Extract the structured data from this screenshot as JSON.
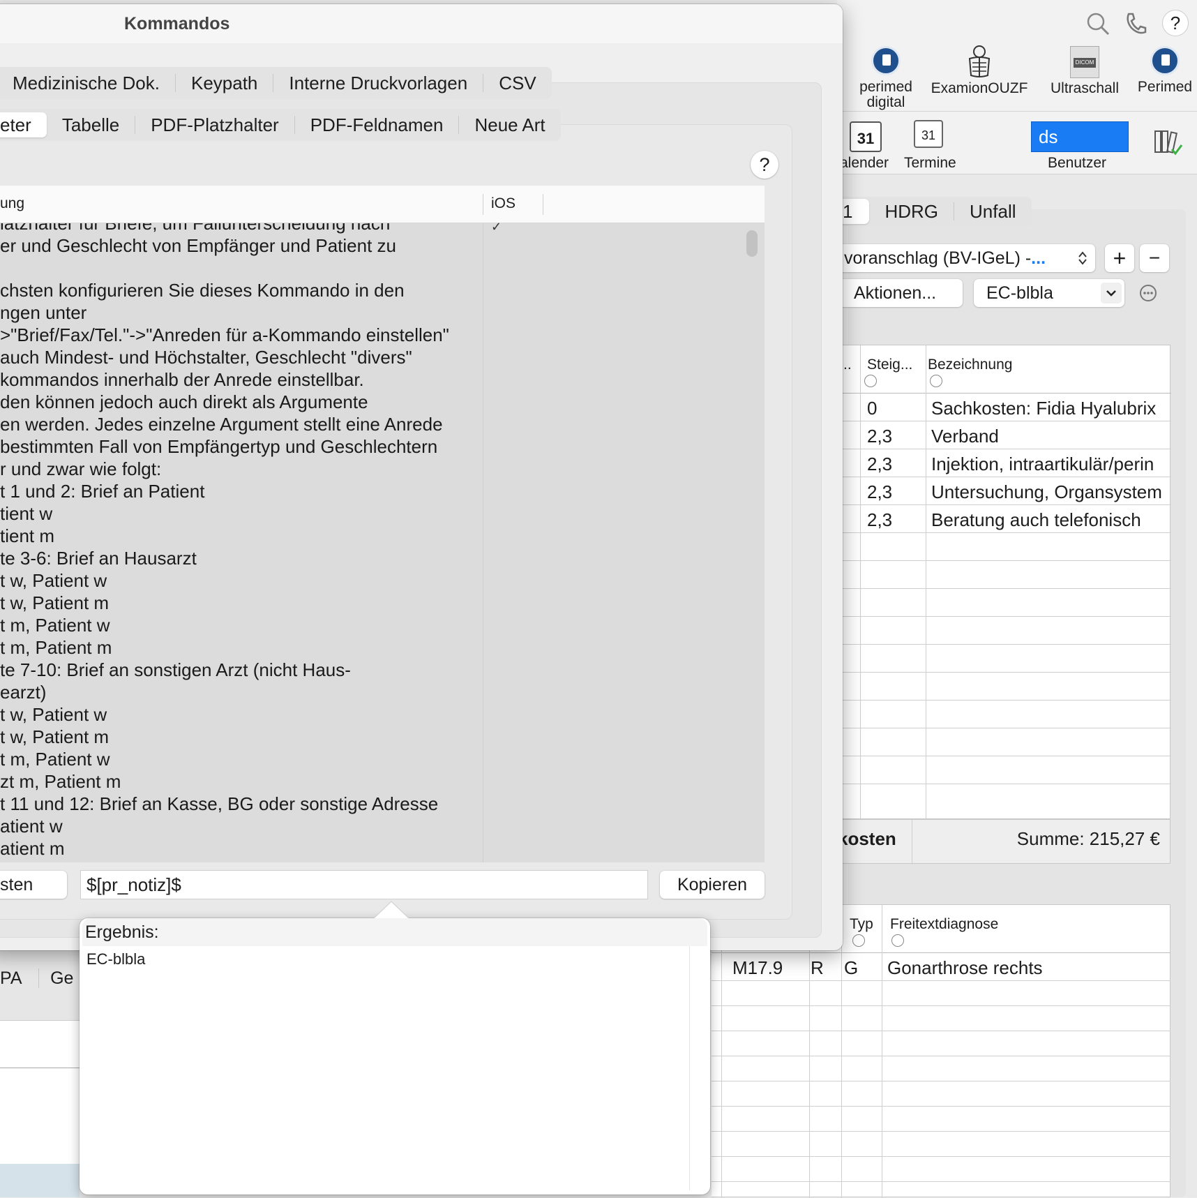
{
  "toolbar": {
    "items": [
      {
        "label": "perimed\ndigital",
        "icon": "perimed-doc-icon"
      },
      {
        "label": "ExamionOUZF",
        "icon": "skeleton-icon"
      },
      {
        "label": "Ultraschall",
        "icon": "dicom-icon"
      },
      {
        "label": "Perimed",
        "icon": "perimed-doc-icon"
      }
    ],
    "row2": {
      "calendar_label": "alender",
      "termine_label": "Termine",
      "calendar_day": "31",
      "benutzer_value": "ds",
      "benutzer_label": "Benutzer"
    }
  },
  "right_tabs": [
    "1",
    "HDRG",
    "Unfall"
  ],
  "right_controls": {
    "cost_select": "voranschlag (BV-IGeL) -",
    "cost_select_ellipsis": "...",
    "plus": "+",
    "minus": "−",
    "actions_button": "Aktionen...",
    "ec_select": "EC-blbla"
  },
  "billing_table": {
    "headers": [
      "..",
      "Steig...",
      "Bezeichnung"
    ],
    "rows": [
      {
        "steig": "0",
        "bez": "Sachkosten: Fidia Hyalubrix"
      },
      {
        "steig": "2,3",
        "bez": "Verband"
      },
      {
        "steig": "2,3",
        "bez": "Injektion, intraartikulär/perin"
      },
      {
        "steig": "2,3",
        "bez": "Untersuchung, Organsystem"
      },
      {
        "steig": "2,3",
        "bez": "Beratung auch telefonisch"
      }
    ],
    "footer_left": "kosten",
    "footer_sum": "Summe: 215,27 €"
  },
  "diagnosis_table": {
    "headers": [
      "Typ",
      "Freitextdiagnose"
    ],
    "rows": [
      {
        "code": "M17.9",
        "side": "R",
        "typ": "G",
        "text": "Gonarthrose rechts"
      }
    ]
  },
  "left_bg_tabs": [
    "PA",
    "Ge"
  ],
  "dialog": {
    "title": "Kommandos",
    "tabs_row1": [
      "Medizinische Dok.",
      "Keypath",
      "Interne Druckvorlagen",
      "CSV"
    ],
    "tabs_row2": [
      "eter",
      "Tabelle",
      "PDF-Platzhalter",
      "PDF-Feldnamen",
      "Neue Art"
    ],
    "help": "?",
    "table_headers": [
      "ung",
      "iOS"
    ],
    "description_lines": [
      "latzhalter für Briefe, um Fallunterscheidung nach",
      "er und Geschlecht von Empfänger und Patient zu",
      "",
      "chsten konfigurieren Sie dieses Kommando in den",
      "ngen unter",
      ">\"Brief/Fax/Tel.\"->\"Anreden für a-Kommando einstellen\"",
      " auch Mindest- und Höchstalter, Geschlecht \"divers\"",
      "kommandos innerhalb der Anrede einstellbar.",
      "den können jedoch auch direkt als Argumente",
      "en werden. Jedes einzelne Argument stellt eine Anrede",
      " bestimmten Fall von Empfängertyp und Geschlechtern",
      "r und zwar wie folgt:",
      "t 1 und 2: Brief an Patient",
      "tient w",
      "tient m",
      "te 3-6: Brief an Hausarzt",
      "t w, Patient w",
      "t w, Patient m",
      "t m, Patient w",
      "t m, Patient m",
      "te 7-10: Brief an sonstigen Arzt (nicht Haus-",
      "earzt)",
      "t w, Patient w",
      "t w, Patient m",
      "t m, Patient w",
      "zt m, Patient m",
      "t 11 und 12: Brief an Kasse, BG oder sonstige Adresse",
      "atient w",
      "atient m"
    ],
    "ios_check": "✓",
    "test_button": "sten",
    "command_input": "$[pr_notiz]$",
    "copy_button": "Kopieren"
  },
  "popover": {
    "label": "Ergebnis:",
    "result": "EC-blbla"
  },
  "colors": {
    "accent": "#1a7cf5",
    "doc_icon": "#1f4f8c"
  }
}
